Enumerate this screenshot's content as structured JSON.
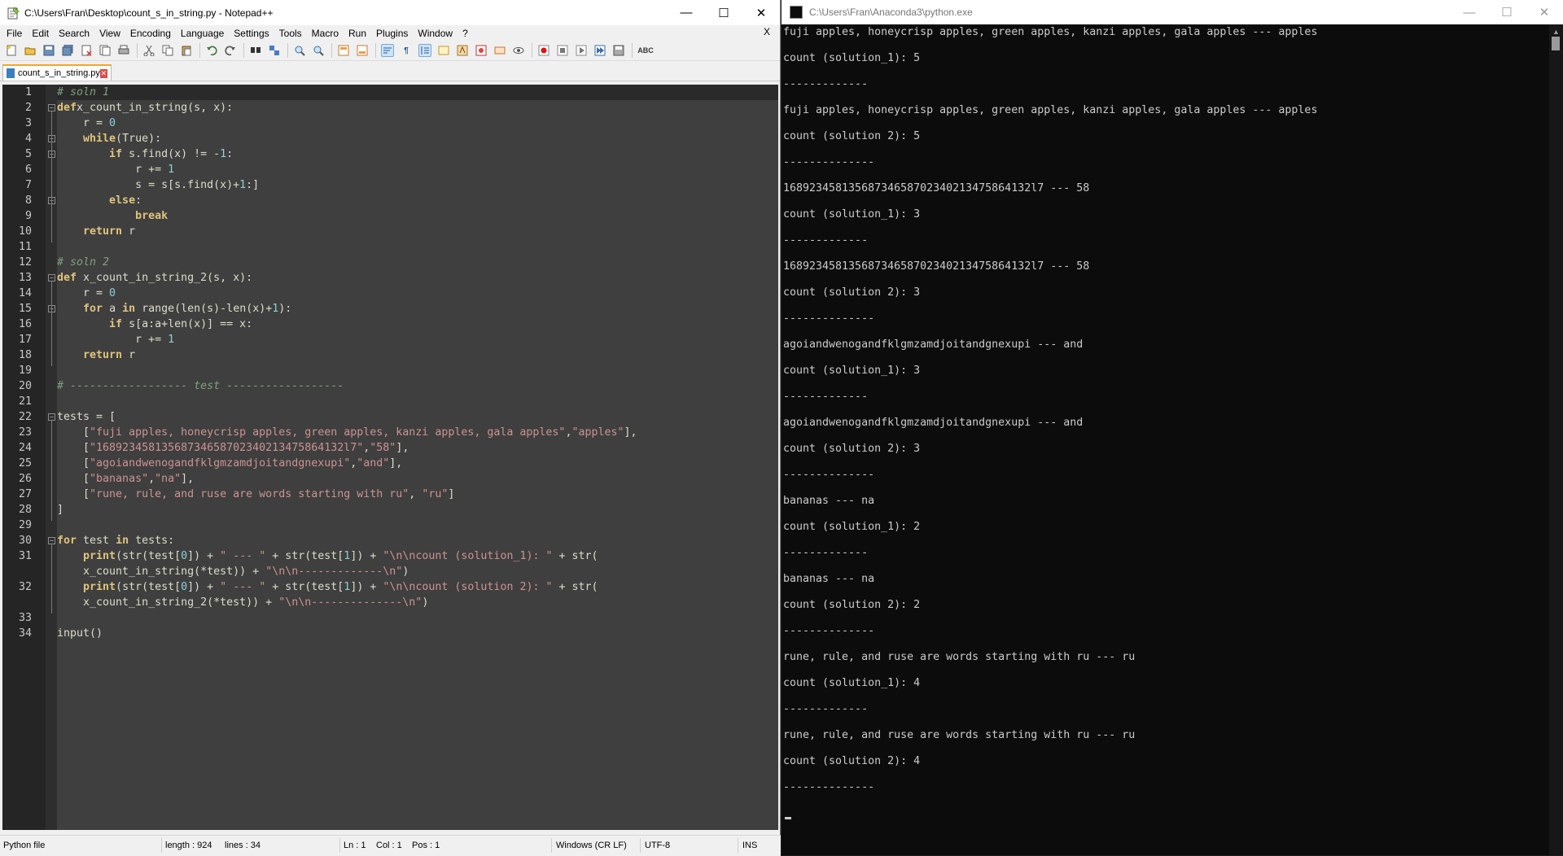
{
  "notepad": {
    "title": "C:\\Users\\Fran\\Desktop\\count_s_in_string.py - Notepad++",
    "menu": [
      "File",
      "Edit",
      "Search",
      "View",
      "Encoding",
      "Language",
      "Settings",
      "Tools",
      "Macro",
      "Run",
      "Plugins",
      "Window",
      "?"
    ],
    "menu_close": "X",
    "tab_label": "count_s_in_string.py",
    "status": {
      "file_type": "Python file",
      "length": "length : 924",
      "lines": "lines : 34",
      "ln": "Ln : 1",
      "col": "Col : 1",
      "pos": "Pos : 1",
      "eol": "Windows (CR LF)",
      "encoding": "UTF-8",
      "mode": "INS"
    },
    "line_numbers": [
      "1",
      "2",
      "3",
      "4",
      "5",
      "6",
      "7",
      "8",
      "9",
      "10",
      "11",
      "12",
      "13",
      "14",
      "15",
      "16",
      "17",
      "18",
      "19",
      "20",
      "21",
      "22",
      "23",
      "24",
      "25",
      "26",
      "27",
      "28",
      "29",
      "30",
      "31",
      "",
      "32",
      "",
      "33",
      "34"
    ],
    "code": [
      [
        [
          "cm",
          "# soln 1"
        ]
      ],
      [
        [
          "kw",
          "def"
        ],
        [
          "",
          "x_count_in_string(s, x):"
        ]
      ],
      [
        [
          "",
          "    r = "
        ],
        [
          "nm",
          "0"
        ]
      ],
      [
        [
          "",
          "    "
        ],
        [
          "kw",
          "while"
        ],
        [
          "",
          "(True):"
        ]
      ],
      [
        [
          "",
          "        "
        ],
        [
          "kw",
          "if"
        ],
        [
          "",
          " s.find(x) != -"
        ],
        [
          "nm",
          "1"
        ],
        [
          "",
          ":"
        ]
      ],
      [
        [
          "",
          "            r += "
        ],
        [
          "nm",
          "1"
        ]
      ],
      [
        [
          "",
          "            s = s[s.find(x)+"
        ],
        [
          "nm",
          "1"
        ],
        [
          "",
          ":]"
        ]
      ],
      [
        [
          "",
          "        "
        ],
        [
          "kw",
          "else"
        ],
        [
          "",
          ":"
        ]
      ],
      [
        [
          "",
          "            "
        ],
        [
          "kw",
          "break"
        ]
      ],
      [
        [
          "",
          "    "
        ],
        [
          "kw",
          "return"
        ],
        [
          "",
          " r"
        ]
      ],
      [
        [
          "",
          ""
        ]
      ],
      [
        [
          "cm",
          "# soln 2"
        ]
      ],
      [
        [
          "kw",
          "def"
        ],
        [
          "",
          " x_count_in_string_2(s, x):"
        ]
      ],
      [
        [
          "",
          "    r = "
        ],
        [
          "nm",
          "0"
        ]
      ],
      [
        [
          "",
          "    "
        ],
        [
          "kw",
          "for"
        ],
        [
          "",
          " a "
        ],
        [
          "kw",
          "in"
        ],
        [
          "",
          " range(len(s)-len(x)+"
        ],
        [
          "nm",
          "1"
        ],
        [
          "",
          "):"
        ]
      ],
      [
        [
          "",
          "        "
        ],
        [
          "kw",
          "if"
        ],
        [
          "",
          " s[a:a+len(x)] == x:"
        ]
      ],
      [
        [
          "",
          "            r += "
        ],
        [
          "nm",
          "1"
        ]
      ],
      [
        [
          "",
          "    "
        ],
        [
          "kw",
          "return"
        ],
        [
          "",
          " r"
        ]
      ],
      [
        [
          "",
          ""
        ]
      ],
      [
        [
          "cm",
          "# ------------------ test ------------------"
        ]
      ],
      [
        [
          "",
          ""
        ]
      ],
      [
        [
          "",
          "tests = ["
        ]
      ],
      [
        [
          "",
          "    ["
        ],
        [
          "st",
          "\"fuji apples, honeycrisp apples, green apples, kanzi apples, gala apples\""
        ],
        [
          "",
          ","
        ],
        [
          "st",
          "\"apples\""
        ],
        [
          "",
          "],"
        ]
      ],
      [
        [
          "",
          "    ["
        ],
        [
          "st",
          "\"16892345813568734658702340213475864132l7\""
        ],
        [
          "",
          ","
        ],
        [
          "st",
          "\"58\""
        ],
        [
          "",
          "],"
        ]
      ],
      [
        [
          "",
          "    ["
        ],
        [
          "st",
          "\"agoiandwenogandfklgmzamdjoitandgnexupi\""
        ],
        [
          "",
          ","
        ],
        [
          "st",
          "\"and\""
        ],
        [
          "",
          "],"
        ]
      ],
      [
        [
          "",
          "    ["
        ],
        [
          "st",
          "\"bananas\""
        ],
        [
          "",
          ","
        ],
        [
          "st",
          "\"na\""
        ],
        [
          "",
          "],"
        ]
      ],
      [
        [
          "",
          "    ["
        ],
        [
          "st",
          "\"rune, rule, and ruse are words starting with ru\""
        ],
        [
          "",
          ", "
        ],
        [
          "st",
          "\"ru\""
        ],
        [
          "",
          "]"
        ]
      ],
      [
        [
          "",
          "]"
        ]
      ],
      [
        [
          "",
          ""
        ]
      ],
      [
        [
          "kw",
          "for"
        ],
        [
          "",
          " test "
        ],
        [
          "kw",
          "in"
        ],
        [
          "",
          " tests:"
        ]
      ],
      [
        [
          "",
          "    "
        ],
        [
          "kw",
          "print"
        ],
        [
          "",
          "(str(test["
        ],
        [
          "nm",
          "0"
        ],
        [
          "",
          "]) + "
        ],
        [
          "st",
          "\" --- \""
        ],
        [
          "",
          " + str(test["
        ],
        [
          "nm",
          "1"
        ],
        [
          "",
          "]) + "
        ],
        [
          "st",
          "\"\\n\\ncount (solution_1): \""
        ],
        [
          "",
          " + str("
        ]
      ],
      [
        [
          "",
          "    x_count_in_string(*test)) + "
        ],
        [
          "st",
          "\"\\n\\n-------------\\n\""
        ],
        [
          "",
          ")"
        ]
      ],
      [
        [
          "",
          "    "
        ],
        [
          "kw",
          "print"
        ],
        [
          "",
          "(str(test["
        ],
        [
          "nm",
          "0"
        ],
        [
          "",
          "]) + "
        ],
        [
          "st",
          "\" --- \""
        ],
        [
          "",
          " + str(test["
        ],
        [
          "nm",
          "1"
        ],
        [
          "",
          "]) + "
        ],
        [
          "st",
          "\"\\n\\ncount (solution 2): \""
        ],
        [
          "",
          " + str("
        ]
      ],
      [
        [
          "",
          "    x_count_in_string_2(*test)) + "
        ],
        [
          "st",
          "\"\\n\\n--------------\\n\""
        ],
        [
          "",
          ")"
        ]
      ],
      [
        [
          "",
          ""
        ]
      ],
      [
        [
          "",
          "input()"
        ]
      ]
    ]
  },
  "console": {
    "title": "C:\\Users\\Fran\\Anaconda3\\python.exe",
    "lines": [
      "fuji apples, honeycrisp apples, green apples, kanzi apples, gala apples --- apples",
      "",
      "count (solution_1): 5",
      "",
      "-------------",
      "",
      "fuji apples, honeycrisp apples, green apples, kanzi apples, gala apples --- apples",
      "",
      "count (solution 2): 5",
      "",
      "--------------",
      "",
      "16892345813568734658702340213475864132l7 --- 58",
      "",
      "count (solution_1): 3",
      "",
      "-------------",
      "",
      "16892345813568734658702340213475864132l7 --- 58",
      "",
      "count (solution 2): 3",
      "",
      "--------------",
      "",
      "agoiandwenogandfklgmzamdjoitandgnexupi --- and",
      "",
      "count (solution_1): 3",
      "",
      "-------------",
      "",
      "agoiandwenogandfklgmzamdjoitandgnexupi --- and",
      "",
      "count (solution 2): 3",
      "",
      "--------------",
      "",
      "bananas --- na",
      "",
      "count (solution_1): 2",
      "",
      "-------------",
      "",
      "bananas --- na",
      "",
      "count (solution 2): 2",
      "",
      "--------------",
      "",
      "rune, rule, and ruse are words starting with ru --- ru",
      "",
      "count (solution_1): 4",
      "",
      "-------------",
      "",
      "rune, rule, and ruse are words starting with ru --- ru",
      "",
      "count (solution 2): 4",
      "",
      "--------------"
    ]
  }
}
